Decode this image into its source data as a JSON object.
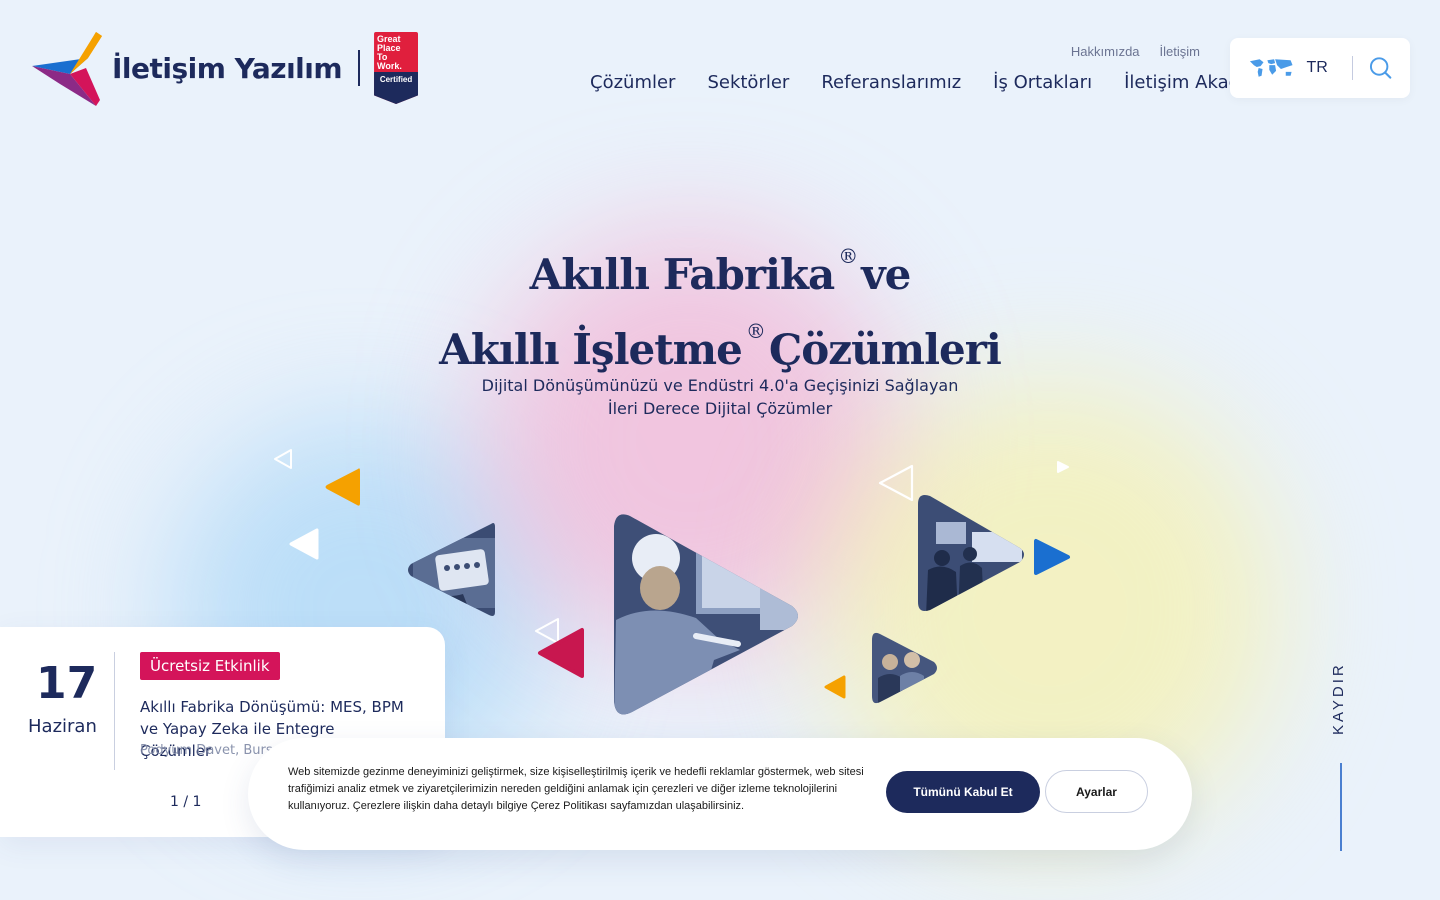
{
  "header": {
    "brand_name": "İletişim Yazılım",
    "badge": {
      "line1": "Great",
      "line2": "Place",
      "line3": "To",
      "line4": "Work.",
      "certified": "Certified"
    },
    "top_links": [
      "Hakkımızda",
      "İletişim"
    ],
    "nav": [
      "Çözümler",
      "Sektörler",
      "Referanslarımız",
      "İş Ortakları",
      "İletişim Akademi"
    ],
    "language": "TR"
  },
  "hero": {
    "title_line1_a": "Akıllı Fabrika",
    "title_line1_b": "ve",
    "title_line2_a": "Akıllı İşletme",
    "title_line2_b": "Çözümleri",
    "registered": "®",
    "subtitle": "Dijital Dönüşümünüzü ve Endüstri 4.0'a Geçişinizi Sağlayan İleri Derece Dijital Çözümler"
  },
  "event": {
    "day": "17",
    "month": "Haziran",
    "badge": "Ücretsiz Etkinlik",
    "title": "Akıllı Fabrika Dönüşümü: MES, BPM ve Yapay Zeka ile Entegre Çözümler",
    "location": "Podyum Davet, Burs",
    "pager": "1 / 1"
  },
  "cookie": {
    "text": "Web sitemizde gezinme deneyiminizi geliştirmek, size kişiselleştirilmiş içerik ve hedefli reklamlar göstermek, web sitesi trafiğimizi analiz etmek ve ziyaretçilerimizin nereden geldiğini anlamak için çerezleri ve diğer izleme teknolojilerini kullanıyoruz. Çerezlere ilişkin daha detaylı bilgiye Çerez Politikası sayfamızdan ulaşabilirsiniz.",
    "accept_label": "Tümünü Kabul Et",
    "settings_label": "Ayarlar"
  },
  "scroll": {
    "label": "KAYDIR"
  },
  "colors": {
    "navy": "#1d2a5c",
    "magenta": "#d4145a",
    "orange": "#f5a100",
    "blue": "#1a6fd0",
    "badge_red": "#e01f3d"
  },
  "icons": [
    "logo-mark-icon",
    "world-map-icon",
    "search-icon"
  ]
}
